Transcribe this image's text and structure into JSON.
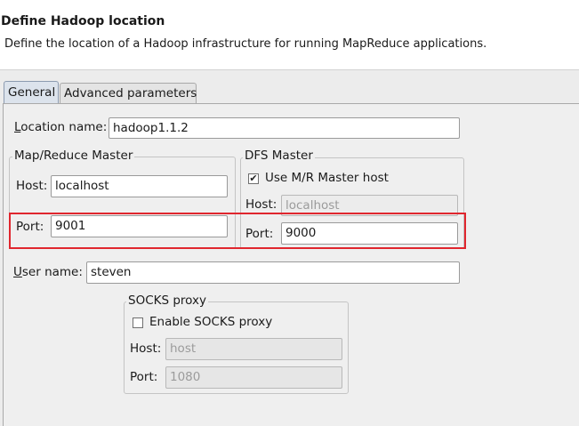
{
  "header": {
    "title": "Define Hadoop location",
    "subtitle": "Define the location of a Hadoop infrastructure for running MapReduce applications."
  },
  "tabs": [
    {
      "label": "General",
      "selected": true
    },
    {
      "label": "Advanced parameters",
      "selected": false
    }
  ],
  "general": {
    "location_name": {
      "label_mnemonic": "L",
      "label_rest": "ocation name:",
      "value": "hadoop1.1.2"
    },
    "mr_master": {
      "legend": "Map/Reduce Master",
      "host_label": "Host:",
      "host_value": "localhost",
      "port_label": "Port:",
      "port_value": "9001"
    },
    "dfs_master": {
      "legend": "DFS Master",
      "use_mr_label": "Use M/R Master host",
      "use_mr_checked": true,
      "host_label": "Host:",
      "host_value": "localhost",
      "port_label": "Port:",
      "port_value": "9000"
    },
    "user_name": {
      "label_mnemonic": "U",
      "label_rest": "ser name:",
      "value": "steven"
    },
    "socks": {
      "legend": "SOCKS proxy",
      "enable_label": "Enable SOCKS proxy",
      "enable_checked": false,
      "host_label": "Host:",
      "host_value": "host",
      "port_label": "Port:",
      "port_value": "1080"
    }
  },
  "colors": {
    "highlight_box": "#e0262e",
    "selected_tab": "#dce3ec"
  }
}
